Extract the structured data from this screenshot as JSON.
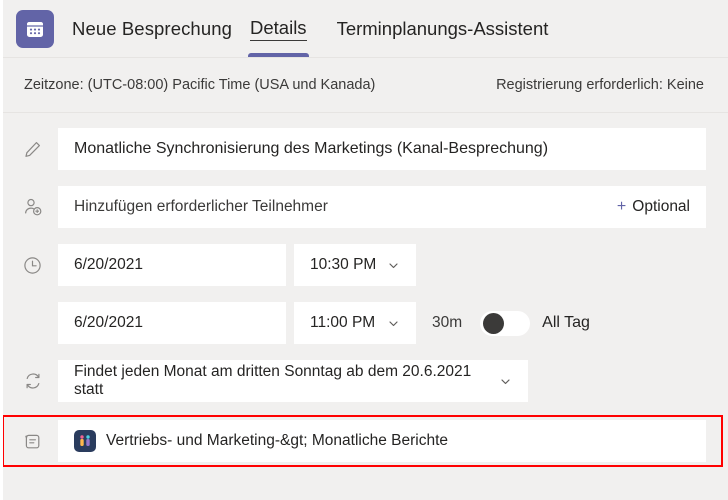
{
  "header": {
    "app_icon": "calendar-icon",
    "title": "Neue Besprechung",
    "tabs": [
      {
        "label": "Details",
        "active": true
      },
      {
        "label": "Terminplanungs-Assistent",
        "active": false
      }
    ]
  },
  "subbar": {
    "timezone": "Zeitzone: (UTC-08:00) Pacific Time (USA und Kanada)",
    "registration": "Registrierung erforderlich: Keine"
  },
  "form": {
    "title_row": {
      "icon": "pencil-icon",
      "value": "Monatliche Synchronisierung des Marketings (Kanal-Besprechung)"
    },
    "attendees_row": {
      "icon": "add-person-icon",
      "placeholder": "Hinzufügen erforderlicher Teilnehmer",
      "optional_plus": "+",
      "optional_label": "Optional"
    },
    "start_row": {
      "icon": "clock-icon",
      "date": "6/20/2021",
      "time": "10:30 PM",
      "chevron": "chevron-down-icon"
    },
    "end_row": {
      "date": "6/20/2021",
      "time": "11:00 PM",
      "chevron": "chevron-down-icon",
      "duration": "30m",
      "all_day_toggle": "off",
      "all_day_label": "All Tag"
    },
    "recurrence_row": {
      "icon": "repeat-icon",
      "value": "Findet jeden Monat am dritten Sonntag ab dem 20.6.2021 statt",
      "chevron": "chevron-down-icon"
    },
    "channel_row": {
      "icon": "channel-icon",
      "team_avatar": "team-avatar-icon",
      "value": "Vertriebs- und Marketing-&gt;  Monatliche Berichte",
      "highlighted": true
    }
  },
  "colors": {
    "accent_purple": "#6264a7",
    "highlight_red": "#ff0000",
    "page_bg": "#f1f0ef",
    "field_bg": "#ffffff",
    "team_avatar_bg": "#2a3c5e"
  }
}
